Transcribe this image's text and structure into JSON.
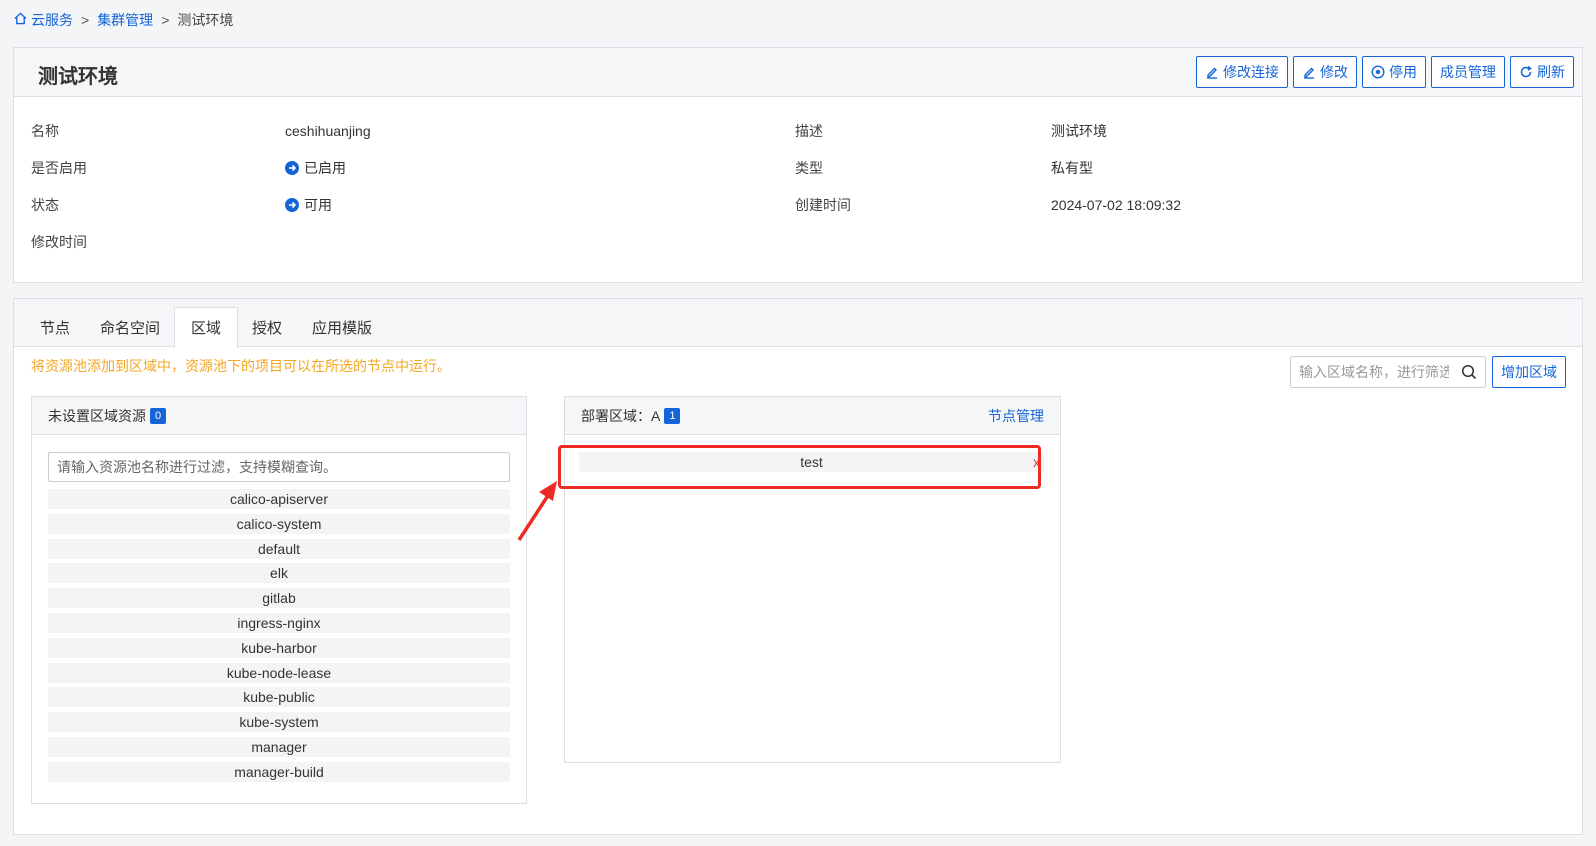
{
  "breadcrumb": {
    "home": "云服务",
    "cluster": "集群管理",
    "current": "测试环境",
    "sep": ">"
  },
  "detail": {
    "title": "测试环境",
    "buttons": {
      "edit_connection": "修改连接",
      "edit": "修改",
      "disable": "停用",
      "members": "成员管理",
      "refresh": "刷新"
    },
    "fields": {
      "name_label": "名称",
      "name_value": "ceshihuanjing",
      "desc_label": "描述",
      "desc_value": "测试环境",
      "enabled_label": "是否启用",
      "enabled_value": "已启用",
      "type_label": "类型",
      "type_value": "私有型",
      "status_label": "状态",
      "status_value": "可用",
      "created_label": "创建时间",
      "created_value": "2024-07-02 18:09:32",
      "modified_label": "修改时间",
      "modified_value": ""
    }
  },
  "tabs": [
    "节点",
    "命名空间",
    "区域",
    "授权",
    "应用模版"
  ],
  "active_tab": "区域",
  "region": {
    "hint": "将资源池添加到区域中，资源池下的项目可以在所选的节点中运行。",
    "search_placeholder": "输入区域名称，进行筛选",
    "add_button": "增加区域",
    "unassigned": {
      "title": "未设置区域资源",
      "count": "0",
      "filter_placeholder": "请输入资源池名称进行过滤，支持模糊查询。",
      "items": [
        "calico-apiserver",
        "calico-system",
        "default",
        "elk",
        "gitlab",
        "ingress-nginx",
        "kube-harbor",
        "kube-node-lease",
        "kube-public",
        "kube-system",
        "manager",
        "manager-build"
      ]
    },
    "deployed": {
      "title": "部署区域：A",
      "count": "1",
      "node_manage": "节点管理",
      "items": [
        "test"
      ],
      "delete_label": "x"
    }
  },
  "colors": {
    "accent": "#1565d8",
    "hint": "#f5a623",
    "highlight": "#ee2a24"
  }
}
